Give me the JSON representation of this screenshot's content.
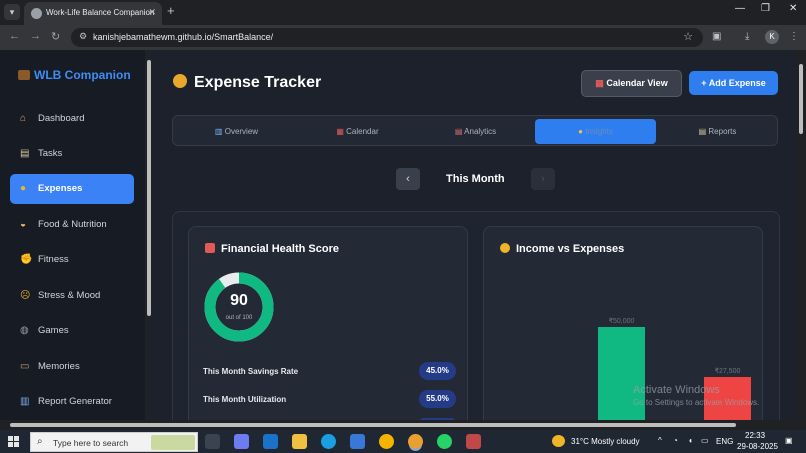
{
  "browser": {
    "tab_title": "Work-Life Balance Companion",
    "url": "kanishjebamathewm.github.io/SmartBalance/",
    "profile_initial": "K"
  },
  "sidebar": {
    "brand": "WLB Companion",
    "items": [
      {
        "label": "Dashboard",
        "icon": "home-icon"
      },
      {
        "label": "Tasks",
        "icon": "clipboard-icon"
      },
      {
        "label": "Expenses",
        "icon": "money-bag-icon",
        "active": true
      },
      {
        "label": "Food & Nutrition",
        "icon": "food-icon"
      },
      {
        "label": "Fitness",
        "icon": "muscle-icon"
      },
      {
        "label": "Stress & Mood",
        "icon": "face-icon"
      },
      {
        "label": "Games",
        "icon": "gamepad-icon"
      },
      {
        "label": "Memories",
        "icon": "photo-icon"
      },
      {
        "label": "Report Generator",
        "icon": "chart-icon"
      }
    ]
  },
  "header": {
    "title": "Expense Tracker",
    "calendar_button": "Calendar View",
    "add_button": "+ Add Expense"
  },
  "tabs": [
    {
      "label": "Overview"
    },
    {
      "label": "Calendar"
    },
    {
      "label": "Analytics"
    },
    {
      "label": "Insights",
      "active": true
    },
    {
      "label": "Reports"
    }
  ],
  "period": {
    "label": "This Month",
    "prev": "‹",
    "next": "›"
  },
  "health_card": {
    "title": "Financial Health Score",
    "score": "90",
    "score_sub": "out of 100",
    "score_value": 90,
    "metrics": [
      {
        "label": "This Month Savings Rate",
        "value": "45.0%"
      },
      {
        "label": "This Month Utilization",
        "value": "55.0%"
      }
    ]
  },
  "income_card": {
    "title": "Income vs Expenses",
    "income_label": "₹50,000",
    "expense_label": "₹27,500",
    "income_value": 50000,
    "expense_value": 27500,
    "income_color": "#10b981",
    "expense_color": "#ef4444"
  },
  "watermark": {
    "line1": "Activate Windows",
    "line2": "Go to Settings to activate Windows."
  },
  "taskbar": {
    "search_placeholder": "Type here to search",
    "weather": "31°C  Mostly cloudy",
    "lang": "ENG",
    "time": "22:33",
    "date": "29-08-2025"
  },
  "colors": {
    "accent": "#3a82f6",
    "background": "#1c212b",
    "sidebar": "#171b23"
  }
}
